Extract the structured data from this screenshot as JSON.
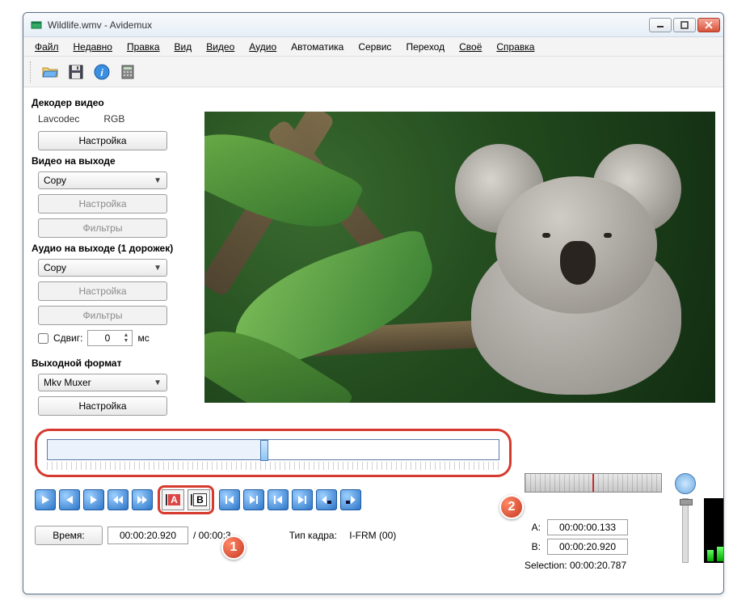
{
  "window": {
    "title": "Wildlife.wmv - Avidemux"
  },
  "menu": {
    "file": "Файл",
    "recent": "Недавно",
    "edit": "Правка",
    "view": "Вид",
    "video": "Видео",
    "audio": "Аудио",
    "automation": "Автоматика",
    "service": "Сервис",
    "go": "Переход",
    "custom": "Своё",
    "help": "Справка"
  },
  "side": {
    "decoder_title": "Декодер видео",
    "decoder_codec": "Lavcodec",
    "decoder_mode": "RGB",
    "configure": "Настройка",
    "video_out_title": "Видео на выходе",
    "video_out_value": "Copy",
    "filters": "Фильтры",
    "audio_out_title": "Аудио на выходе (1 дорожек)",
    "audio_out_value": "Copy",
    "shift_label": "Сдвиг:",
    "shift_value": "0",
    "shift_unit": "мс",
    "output_fmt_title": "Выходной формат",
    "output_fmt_value": "Mkv Muxer"
  },
  "time": {
    "button": "Время:",
    "current": "00:00:20.920",
    "total_prefix": "/ 00:00:3",
    "frame_type_label": "Тип кадра:",
    "frame_type_value": "I-FRM (00)"
  },
  "ab": {
    "a_label": "A:",
    "a_value": "00:00:00.133",
    "b_label": "B:",
    "b_value": "00:00:20.920",
    "selection_label": "Selection:",
    "selection_value": "00:00:20.787"
  },
  "badges": {
    "one": "1",
    "two": "2"
  }
}
